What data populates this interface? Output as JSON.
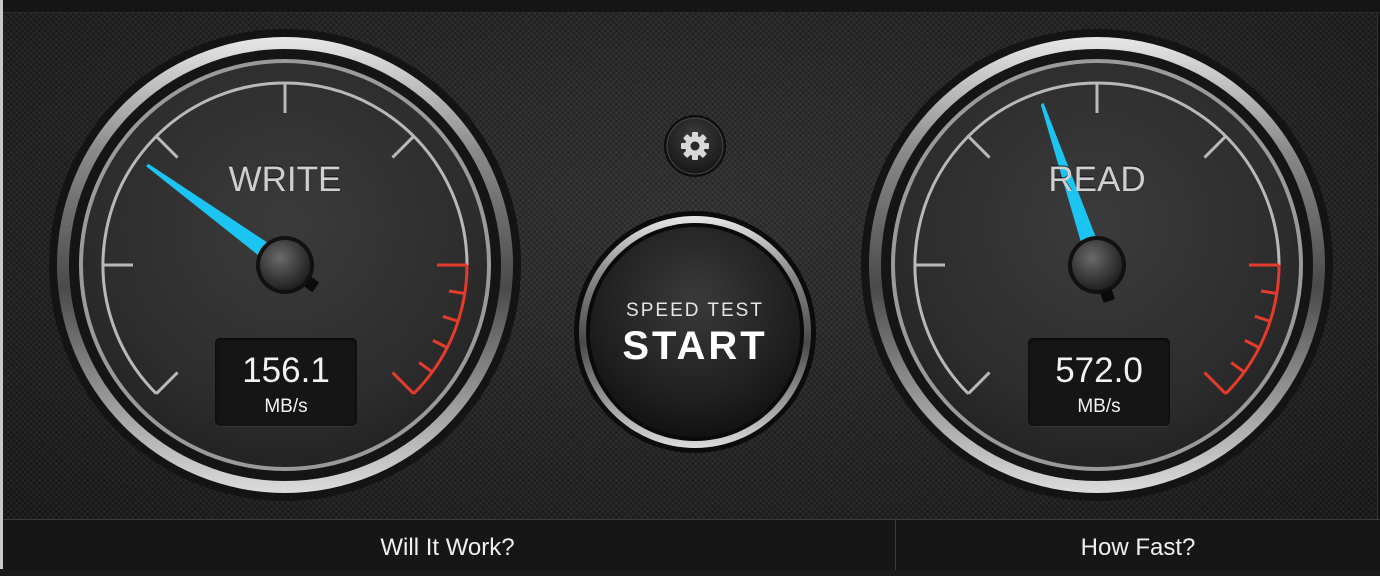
{
  "write_gauge": {
    "label": "WRITE",
    "value": "156.1",
    "unit": "MB/s",
    "needle_level": 0.3
  },
  "read_gauge": {
    "label": "READ",
    "value": "572.0",
    "unit": "MB/s",
    "needle_level": 0.43
  },
  "settings": {
    "icon": "gear-icon"
  },
  "start_button": {
    "caption": "SPEED TEST",
    "label": "START"
  },
  "bottom_tabs": [
    {
      "label": "Will It Work?"
    },
    {
      "label": "How Fast?"
    }
  ],
  "colors": {
    "needle": "#1cc4f2",
    "redline": "#e53b2c"
  }
}
